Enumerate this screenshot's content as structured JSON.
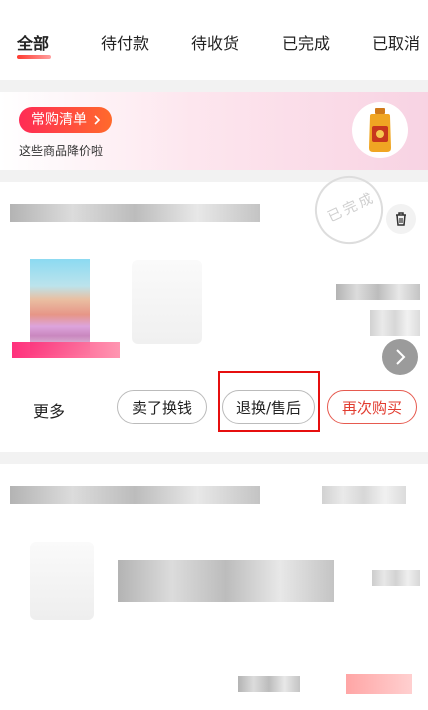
{
  "tabs": [
    {
      "label": "全部",
      "active": true
    },
    {
      "label": "待付款"
    },
    {
      "label": "待收货"
    },
    {
      "label": "已完成"
    },
    {
      "label": "已取消"
    }
  ],
  "banner": {
    "pill_label": "常购清单",
    "subtitle": "这些商品降价啦"
  },
  "order1": {
    "status_stamp": "已完成",
    "actions": {
      "more": "更多",
      "sell": "卖了换钱",
      "after_sale": "退换/售后",
      "rebuy": "再次购买"
    }
  },
  "colors": {
    "accent_red": "#e23c30",
    "highlight": "#e60f0f"
  },
  "icons": [
    "chevron-right-icon",
    "trash-icon",
    "arrow-right-icon"
  ]
}
